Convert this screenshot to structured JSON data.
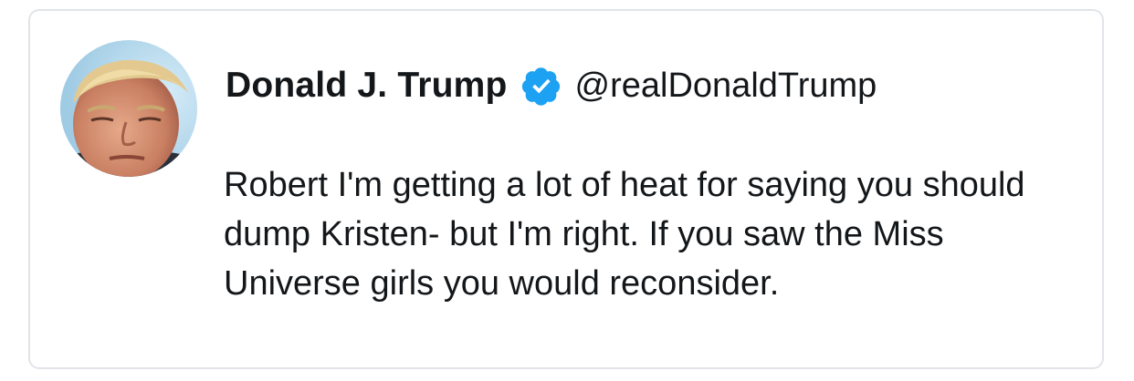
{
  "tweet": {
    "author_name": "Donald J. Trump",
    "handle": "@realDonaldTrump",
    "verified": true,
    "text": "Robert I'm getting a lot of heat for saying you should dump Kristen- but I'm right. If you saw the Miss Universe girls you would reconsider."
  },
  "icons": {
    "verified_badge": "verified-check-icon",
    "avatar": "profile-photo"
  },
  "colors": {
    "verified_blue": "#1da1f2",
    "text": "#14171a",
    "border": "#e1e4e8",
    "background": "#ffffff"
  }
}
